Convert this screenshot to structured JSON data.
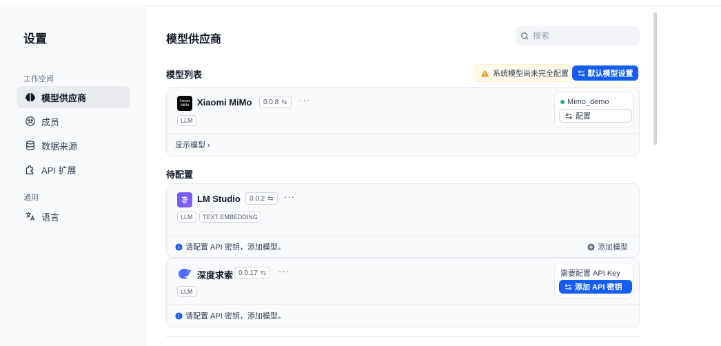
{
  "sidebar": {
    "title": "设置",
    "group_workspace": "工作空间",
    "group_general": "通用",
    "items": [
      {
        "label": "模型供应商",
        "icon": "brain-icon"
      },
      {
        "label": "成员",
        "icon": "members-icon"
      },
      {
        "label": "数据来源",
        "icon": "database-icon"
      },
      {
        "label": "API 扩展",
        "icon": "puzzle-icon"
      },
      {
        "label": "语言",
        "icon": "translate-icon"
      }
    ]
  },
  "header": {
    "title": "模型供应商",
    "search_placeholder": "搜索"
  },
  "model_list": {
    "title": "模型列表",
    "warning": "系统模型尚未完全配置",
    "default_button": "默认模型设置"
  },
  "configured": [
    {
      "name": "Xiaomi MiMo",
      "logo_text": "Xiaomi MiMo",
      "version": "0.0.8",
      "more": "···",
      "tags": [
        "LLM"
      ],
      "status": "Mimo_demo",
      "config_label": "配置",
      "footer": "显示模型 ›"
    }
  ],
  "pending": {
    "title": "待配置",
    "providers": [
      {
        "name": "LM Studio",
        "version": "0.0.2",
        "more": "···",
        "tags": [
          "LLM",
          "TEXT EMBEDDING"
        ],
        "footer": "请配置 API 密钥，添加模型。",
        "add_model": "添加模型"
      },
      {
        "name": "深度求索",
        "version": "0.0.17",
        "more": "···",
        "tags": [
          "LLM"
        ],
        "needs_key": "需要配置 API Key",
        "add_key": "添加 API 密钥",
        "footer": "请配置 API 密钥，添加模型。"
      }
    ]
  },
  "colors": {
    "accent": "#155eef",
    "warning": "#f79009",
    "success": "#17b26a"
  }
}
